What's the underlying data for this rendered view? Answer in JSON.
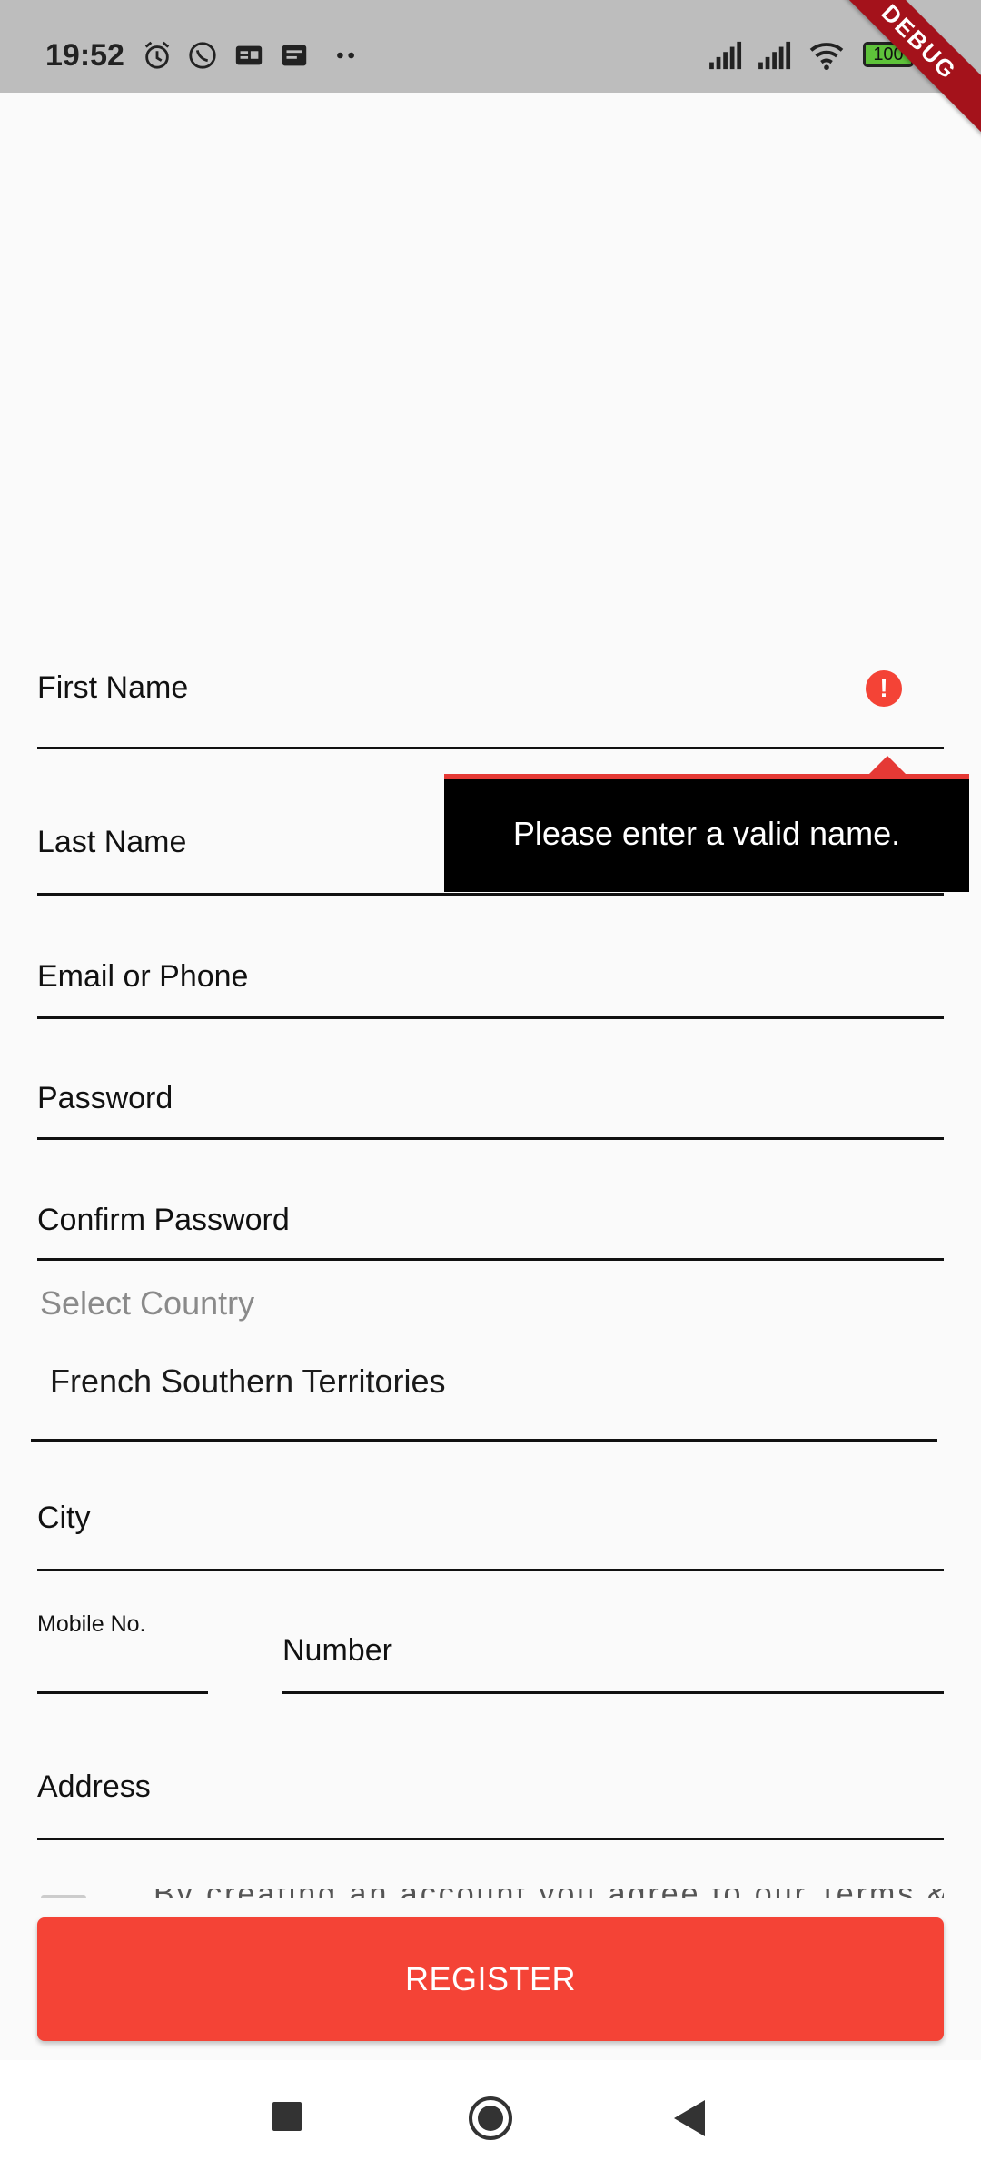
{
  "status_bar": {
    "time": "19:52",
    "battery": "100",
    "icons": [
      "alarm-icon",
      "whatsapp-icon",
      "id-card-icon",
      "message-icon",
      "more-dots-icon",
      "signal-icon",
      "signal-icon",
      "wifi-icon",
      "battery-icon"
    ]
  },
  "debug_banner": "DEBUG",
  "form": {
    "first_name_label": "First Name",
    "last_name_label": "Last Name",
    "email_label": "Email or Phone",
    "password_label": "Password",
    "confirm_password_label": "Confirm Password",
    "country_hint": "Select Country",
    "country_value": "French Southern Territories",
    "city_label": "City",
    "mobile_code_label": "Mobile No.",
    "number_label": "Number",
    "address_label": "Address",
    "terms_text": "By creating an account you agree to our Terms & Conditions and"
  },
  "error": {
    "tooltip_text": "Please enter a valid name.",
    "icon_color": "#f44336"
  },
  "register_label": "REGISTER",
  "colors": {
    "accent": "#f44336",
    "banner": "#a4121b"
  }
}
